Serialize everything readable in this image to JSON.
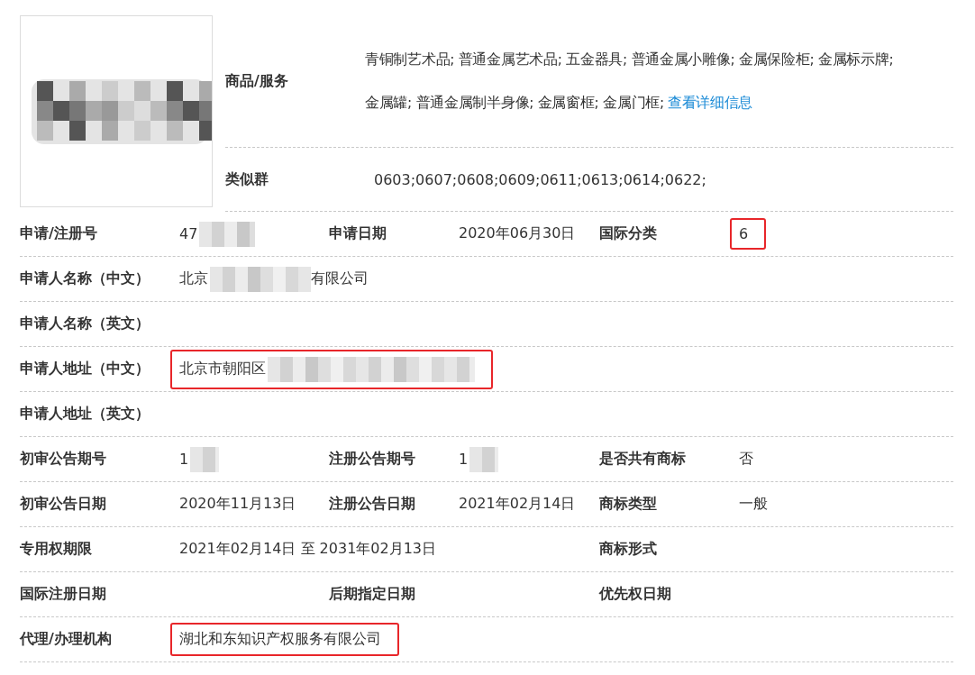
{
  "goods": {
    "label": "商品/服务",
    "lines": [
      "青铜制艺术品; 普通金属艺术品; 五金器具; 普通金属小雕像; 金属保险柜; 金属标示牌;",
      "金属罐; 普通金属制半身像; 金属窗框; 金属门框;"
    ],
    "link": "查看详细信息"
  },
  "similar_groups": {
    "label": "类似群",
    "value": "0603;0607;0608;0609;0611;0613;0614;0622;"
  },
  "rows": [
    {
      "cells": [
        {
          "kind": "field",
          "label": "申请/注册号",
          "highlighted": false,
          "parts": [
            {
              "kind": "text",
              "text": "47"
            },
            {
              "kind": "mosaic"
            }
          ]
        },
        {
          "kind": "field",
          "label": "申请日期",
          "highlighted": false,
          "parts": [
            {
              "kind": "text",
              "text": "2020年06月30日"
            }
          ]
        },
        {
          "kind": "field",
          "label": "国际分类",
          "highlighted": true,
          "parts": [
            {
              "kind": "text",
              "text": "6"
            }
          ]
        }
      ]
    },
    {
      "cells": [
        {
          "kind": "field",
          "label": "申请人名称（中文）",
          "highlighted": false,
          "parts": [
            {
              "kind": "text",
              "text": "北京"
            },
            {
              "kind": "mosaic"
            },
            {
              "kind": "text",
              "text": "有限公司"
            }
          ]
        }
      ]
    },
    {
      "cells": [
        {
          "kind": "field",
          "label": "申请人名称（英文）"
        }
      ]
    },
    {
      "cells": [
        {
          "kind": "field",
          "label": "申请人地址（中文）",
          "highlighted": true,
          "parts": [
            {
              "kind": "text",
              "text": "北京市朝阳区"
            },
            {
              "kind": "mosaic"
            }
          ]
        }
      ]
    },
    {
      "cells": [
        {
          "kind": "field",
          "label": "申请人地址（英文）"
        }
      ]
    },
    {
      "cells": [
        {
          "kind": "field",
          "label": "初审公告期号",
          "highlighted": false,
          "parts": [
            {
              "kind": "text",
              "text": "1"
            },
            {
              "kind": "mosaic"
            }
          ]
        },
        {
          "kind": "field",
          "label": "注册公告期号",
          "highlighted": false,
          "parts": [
            {
              "kind": "text",
              "text": "1"
            },
            {
              "kind": "mosaic"
            }
          ]
        },
        {
          "kind": "field",
          "label": "是否共有商标",
          "highlighted": false,
          "parts": [
            {
              "kind": "text",
              "text": "否"
            }
          ]
        }
      ]
    },
    {
      "cells": [
        {
          "kind": "field",
          "label": "初审公告日期",
          "highlighted": false,
          "parts": [
            {
              "kind": "text",
              "text": "2020年11月13日"
            }
          ]
        },
        {
          "kind": "field",
          "label": "注册公告日期",
          "highlighted": false,
          "parts": [
            {
              "kind": "text",
              "text": "2021年02月14日"
            }
          ]
        },
        {
          "kind": "field",
          "label": "商标类型",
          "highlighted": false,
          "parts": [
            {
              "kind": "text",
              "text": "一般"
            }
          ]
        }
      ]
    },
    {
      "cells": [
        {
          "kind": "field",
          "label": "专用权期限",
          "highlighted": false,
          "parts": [
            {
              "kind": "text",
              "text": "2021年02月14日 至 2031年02月13日"
            }
          ]
        },
        {
          "kind": "empty"
        },
        {
          "kind": "field",
          "label": "商标形式"
        }
      ]
    },
    {
      "cells": [
        {
          "kind": "field",
          "label": "国际注册日期"
        },
        {
          "kind": "field",
          "label": "后期指定日期"
        },
        {
          "kind": "field",
          "label": "优先权日期"
        }
      ]
    },
    {
      "cells": [
        {
          "kind": "field",
          "label": "代理/办理机构",
          "highlighted": true,
          "parts": [
            {
              "kind": "text",
              "text": "湖北和东知识产权服务有限公司"
            }
          ]
        }
      ]
    }
  ]
}
